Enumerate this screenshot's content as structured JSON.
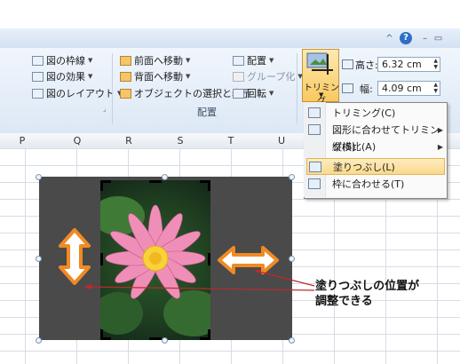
{
  "window": {
    "controls": [
      "^",
      "?",
      "–",
      "▭"
    ]
  },
  "ribbon": {
    "group1": {
      "items": [
        "図の枠線",
        "図の効果",
        "図のレイアウト"
      ]
    },
    "group2": {
      "items": [
        "前面へ移動",
        "背面へ移動",
        "オブジェクトの選択と表示"
      ],
      "label": "配置"
    },
    "group3": {
      "items": [
        "配置",
        "グループ化",
        "回転"
      ]
    },
    "size": {
      "trim_label": "トリミング",
      "height_label": "高さ:",
      "height_value": "6.32 cm",
      "width_label": "幅:",
      "width_value": "4.09 cm"
    }
  },
  "columns": [
    "P",
    "Q",
    "R",
    "S",
    "T",
    "U"
  ],
  "menu": {
    "items": [
      {
        "label": "トリミング(C)",
        "icon": "crop-icon"
      },
      {
        "label": "図形に合わせてトリミング(S)",
        "icon": "shape-crop-icon",
        "submenu": true
      },
      {
        "label": "縦横比(A)",
        "icon": "",
        "submenu": true
      },
      {
        "label": "塗りつぶし(L)",
        "icon": "fill-icon",
        "highlighted": true
      },
      {
        "label": "枠に合わせる(T)",
        "icon": "fit-icon"
      }
    ]
  },
  "callout": {
    "line1": "塗りつぶしの位置が",
    "line2": "調整できる"
  },
  "colors": {
    "accent_orange": "#f08a24",
    "arrow_red": "#c0282c",
    "highlight": "#fbd98b"
  }
}
